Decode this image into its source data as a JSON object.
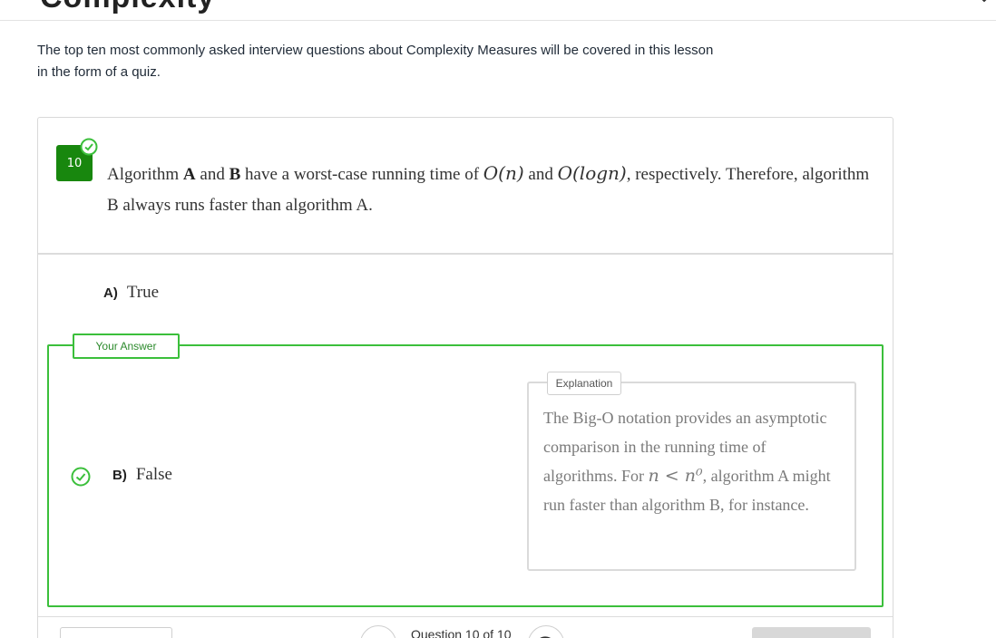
{
  "lesson": {
    "heading_partial": "Complexity",
    "intro": "The top ten most commonly asked interview questions about Complexity Measures will be covered in this lesson in the form of a quiz."
  },
  "quiz": {
    "question_number": "10",
    "question": {
      "p1": "Algorithm ",
      "a": "A",
      "p2": " and ",
      "b": "B",
      "p3": " have a worst-case running time of ",
      "m1": "O(n)",
      "p4": " and ",
      "m2": "O(logn)",
      "p5": ", respectively. Therefore, algorithm B always runs faster than algorithm A."
    },
    "options": [
      {
        "letter": "A)",
        "text": "True"
      },
      {
        "letter": "B)",
        "text": "False"
      }
    ],
    "your_answer_label": "Your Answer",
    "explanation_label": "Explanation",
    "explanation": {
      "p1": "The Big-O notation provides an asymptotic comparison in the running time of algorithms. For ",
      "math": "n < n⁰",
      "p2": ", algorithm A might run faster than algorithm B, for instance."
    },
    "counter": "Question 10 of 10"
  },
  "colors": {
    "badge": "#18870e",
    "correct": "#3bbf3b"
  },
  "icons": [
    "check-circle-icon",
    "chevron-left-icon",
    "chevron-right-icon"
  ]
}
